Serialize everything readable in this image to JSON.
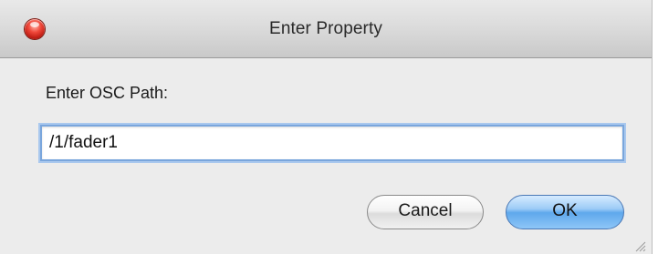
{
  "window": {
    "title": "Enter Property"
  },
  "dialog": {
    "prompt_label": "Enter OSC Path:",
    "path_value": "/1/fader1",
    "cancel_label": "Cancel",
    "ok_label": "OK"
  },
  "icons": {
    "close": "close-icon",
    "resize": "resize-grip-icon"
  },
  "colors": {
    "focus_ring": "#7aa6dc",
    "default_button": "#5fa8ec",
    "close_button": "#f0483a"
  }
}
